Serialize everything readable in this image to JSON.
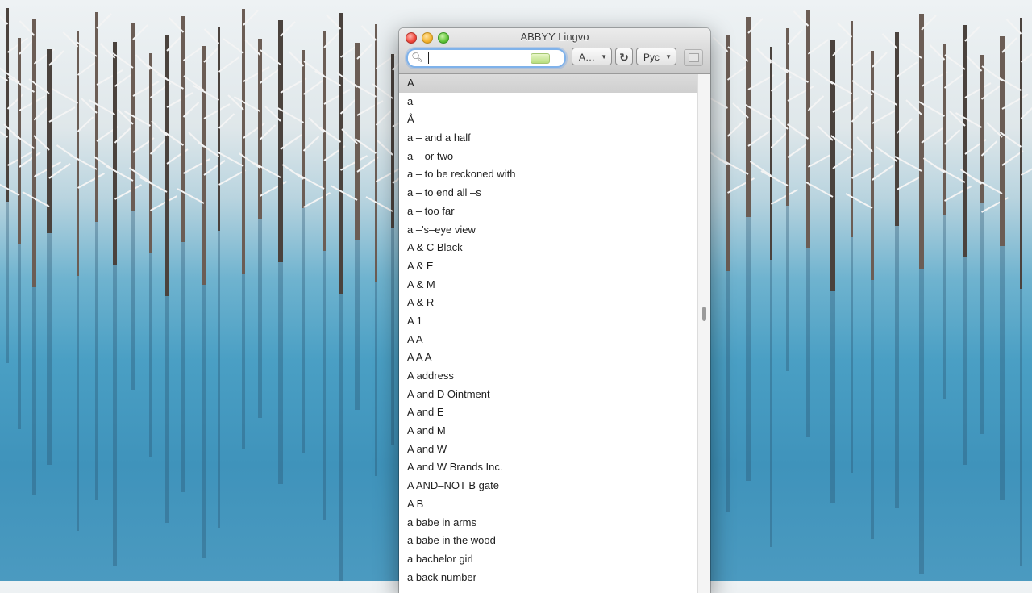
{
  "window": {
    "title": "ABBYY Lingvo"
  },
  "toolbar": {
    "search_icon": "search-icon",
    "search_value": "",
    "direction_label": "A…",
    "swap_icon": "refresh-swap-icon",
    "language_label": "Рус",
    "dropdown_icon": "chevron-down-icon",
    "card_icon": "card-icon"
  },
  "colors": {
    "accent": "#7fb2ea",
    "selection": "#d5d5d5",
    "close": "#f0473c",
    "minimize": "#f3b22c",
    "zoom": "#5fc437"
  },
  "wordlist": [
    "A",
    "a",
    "Å",
    "a – and a half",
    "a – or two",
    "a – to be reckoned with",
    "a – to end all –s",
    "a – too far",
    "a –'s–eye view",
    "A & C Black",
    "A & E",
    "A & M",
    "A & R",
    "A 1",
    "A A",
    "A A A",
    "A address",
    "A and D Ointment",
    "A and E",
    "A and M",
    "A and W",
    "A and W Brands Inc.",
    "A AND–NOT B gate",
    "A B",
    "a babe in arms",
    "a babe in the wood",
    "a bachelor girl",
    "a back number"
  ],
  "selected_index": 0
}
